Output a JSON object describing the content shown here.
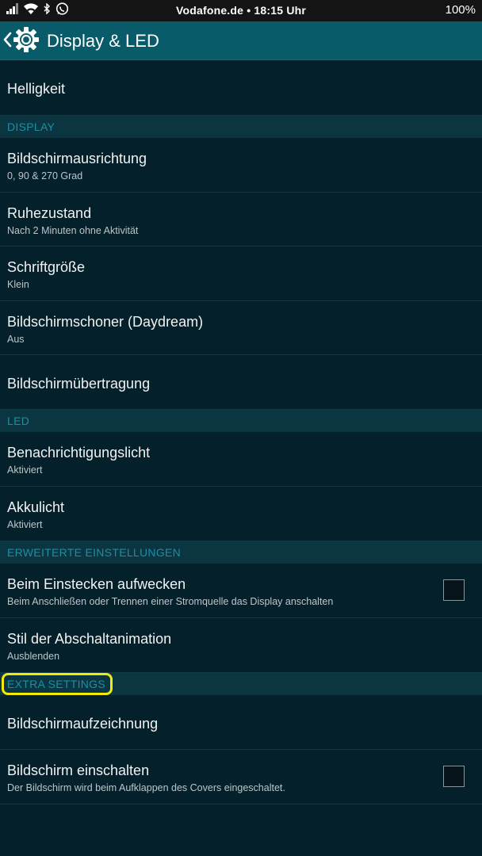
{
  "status_bar": {
    "carrier_time": "Vodafone.de • 18:15  Uhr",
    "battery": "100%",
    "icons": [
      "signal-icon",
      "wifi-icon",
      "bluetooth-icon",
      "whatsapp-icon"
    ]
  },
  "action_bar": {
    "title": "Display & LED",
    "icon": "settings-gear-icon"
  },
  "items": {
    "brightness": {
      "title": "Helligkeit"
    },
    "orientation": {
      "title": "Bildschirmausrichtung",
      "subtitle": "0, 90 & 270 Grad"
    },
    "sleep": {
      "title": "Ruhezustand",
      "subtitle": "Nach 2 Minuten ohne Aktivität"
    },
    "font_size": {
      "title": "Schriftgröße",
      "subtitle": "Klein"
    },
    "daydream": {
      "title": "Bildschirmschoner (Daydream)",
      "subtitle": "Aus"
    },
    "cast": {
      "title": "Bildschirmübertragung"
    },
    "notification_light": {
      "title": "Benachrichtigungslicht",
      "subtitle": "Aktiviert"
    },
    "battery_light": {
      "title": "Akkulicht",
      "subtitle": "Aktiviert"
    },
    "wake_on_plug": {
      "title": "Beim Einstecken aufwecken",
      "subtitle": "Beim Anschließen oder Trennen einer Stromquelle das Display anschalten",
      "checked": false
    },
    "shutdown_animation": {
      "title": "Stil der Abschaltanimation",
      "subtitle": "Ausblenden"
    },
    "screen_record": {
      "title": "Bildschirmaufzeichnung"
    },
    "screen_on": {
      "title": "Bildschirm einschalten",
      "subtitle": "Der Bildschirm wird beim Aufklappen des Covers eingeschaltet.",
      "checked": false
    }
  },
  "sections": {
    "display": "DISPLAY",
    "led": "LED",
    "advanced": "ERWEITERTE EINSTELLUNGEN",
    "extra": "EXTRA SETTINGS"
  },
  "colors": {
    "background": "#04202a",
    "action_bar": "#0a5b69",
    "section_text": "#1a8fa5",
    "highlight": "#f2ea0a"
  }
}
